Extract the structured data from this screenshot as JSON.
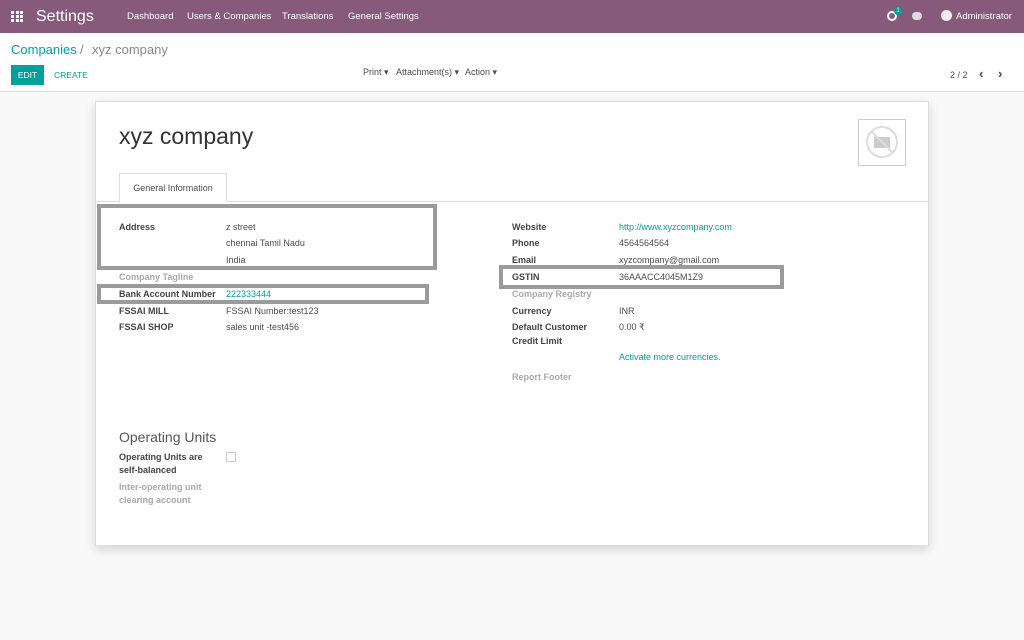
{
  "navbar": {
    "app_title": "Settings",
    "menu": [
      "Dashboard",
      "Users & Companies",
      "Translations",
      "General Settings"
    ],
    "activity_count": "1",
    "user": "Administrator",
    "color": "#875a7b"
  },
  "breadcrumb": {
    "parent": "Companies",
    "separator": "/",
    "current": "xyz company"
  },
  "toolbar": {
    "edit": "EDIT",
    "create": "CREATE",
    "print": "Print",
    "attachments": "Attachment(s)",
    "action": "Action",
    "pager": "2 / 2"
  },
  "form": {
    "name": "xyz company",
    "tab": "General Information",
    "left": {
      "address_label": "Address",
      "address": [
        "z street",
        "chennai  Tamil Nadu",
        "India"
      ],
      "tagline_label": "Company Tagline",
      "bank_label": "Bank Account Number",
      "bank": "222333444",
      "fssai_mill_label": "FSSAI MILL",
      "fssai_mill": "FSSAI Number:test123",
      "fssai_shop_label": "FSSAI SHOP",
      "fssai_shop": "sales unit -test456"
    },
    "right": {
      "website_label": "Website",
      "website": "http://www.xyzcompany.com",
      "phone_label": "Phone",
      "phone": "4564564564",
      "email_label": "Email",
      "email": "xyzcompany@gmail.com",
      "gstin_label": "GSTIN",
      "gstin": "36AAACC4045M1Z9",
      "registry_label": "Company Registry",
      "currency_label": "Currency",
      "currency": "INR",
      "credit_label_1": "Default Customer",
      "credit_label_2": "Credit Limit",
      "credit": "0.00 ₹",
      "activate_link": "Activate more currencies.",
      "footer_label": "Report Footer"
    },
    "operating": {
      "title": "Operating Units",
      "balanced_label_1": "Operating Units are",
      "balanced_label_2": "self-balanced",
      "balanced_checked": false,
      "clearing_label_1": "Inter-operating unit",
      "clearing_label_2": "clearing account"
    }
  },
  "accent": "#00a09d"
}
